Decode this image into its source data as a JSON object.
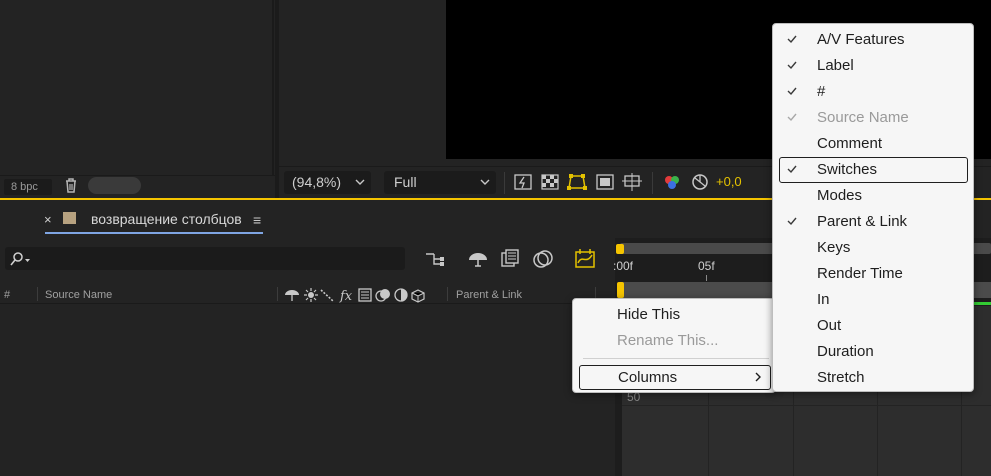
{
  "project": {
    "bpc_label": "8 bpc"
  },
  "viewer": {
    "zoom": "(94,8%)",
    "quality": "Full",
    "exposure": "+0,0"
  },
  "timeline": {
    "tab_close": "×",
    "tab_title": "возвращение столбцов",
    "tab_menu": "≡",
    "columns": {
      "hash": "#",
      "source_name": "Source Name",
      "parent_link": "Parent & Link"
    },
    "ruler": {
      "start": ":00f",
      "mark_05": "05f"
    },
    "row_number": "50"
  },
  "context_menu": {
    "hide_this": "Hide This",
    "rename_this": "Rename This...",
    "columns": "Columns"
  },
  "columns_submenu": {
    "items": [
      {
        "label": "A/V Features",
        "checked": true,
        "disabled": false
      },
      {
        "label": "Label",
        "checked": true,
        "disabled": false
      },
      {
        "label": "#",
        "checked": true,
        "disabled": false
      },
      {
        "label": "Source Name",
        "checked": true,
        "disabled": true
      },
      {
        "label": "Comment",
        "checked": false,
        "disabled": false
      },
      {
        "label": "Switches",
        "checked": true,
        "disabled": false
      },
      {
        "label": "Modes",
        "checked": false,
        "disabled": false
      },
      {
        "label": "Parent & Link",
        "checked": true,
        "disabled": false
      },
      {
        "label": "Keys",
        "checked": false,
        "disabled": false
      },
      {
        "label": "Render Time",
        "checked": false,
        "disabled": false
      },
      {
        "label": "In",
        "checked": false,
        "disabled": false
      },
      {
        "label": "Out",
        "checked": false,
        "disabled": false
      },
      {
        "label": "Duration",
        "checked": false,
        "disabled": false
      },
      {
        "label": "Stretch",
        "checked": false,
        "disabled": false
      }
    ]
  },
  "colors": {
    "accent_yellow": "#f5c400",
    "label_swatch": "#b7a280",
    "timeline_green": "#33cc33"
  }
}
